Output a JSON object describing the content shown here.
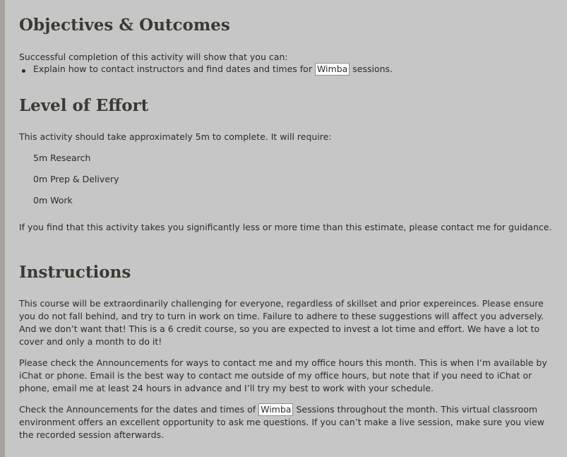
{
  "objectives": {
    "heading": "Objectives & Outcomes",
    "intro": "Successful completion of this activity will show that you can:",
    "bullet_before": "Explain how to contact instructors and find dates and times for",
    "bullet_link": "Wimba",
    "bullet_after": "sessions."
  },
  "effort": {
    "heading": "Level of Effort",
    "intro": "This activity should take approximately 5m to complete. It will require:",
    "items": [
      "5m Research",
      "0m Prep & Delivery",
      "0m Work"
    ],
    "note": "If you find that this activity takes you significantly less or more time than this estimate, please contact me for guidance."
  },
  "instructions": {
    "heading": "Instructions",
    "para1_lines": [
      "This course will be extraordinarily challenging for everyone, regardless of skillset and prior expereinces. Please ensure",
      "you do not fall behind, and try to turn in work on time. Failure to adhere to these suggestions will affect you adversely.",
      "And we don’t want that! This is a 6 credit course, so you are expected to invest a lot time and effort. We have a lot to",
      "cover and only a month to do it!"
    ],
    "para2_lines": [
      "Please check the Announcements for ways to contact me and my office hours this month. This is when I’m available by",
      "iChat or phone. Email is the best way to contact me outside of my office hours, but note that if you need to iChat or",
      "phone, email me at least 24 hours in advance and I’ll try my best to work with your schedule."
    ],
    "para3_first_before": "Check the Announcements for the dates and times of",
    "para3_link": "Wimba",
    "para3_first_after": "Sessions throughout the month. This virtual classroom",
    "para3_lines": [
      "environment offers an excellent opportunity to ask me questions. If you can’t make a live session, make sure you view",
      "the recorded session afterwards."
    ]
  }
}
